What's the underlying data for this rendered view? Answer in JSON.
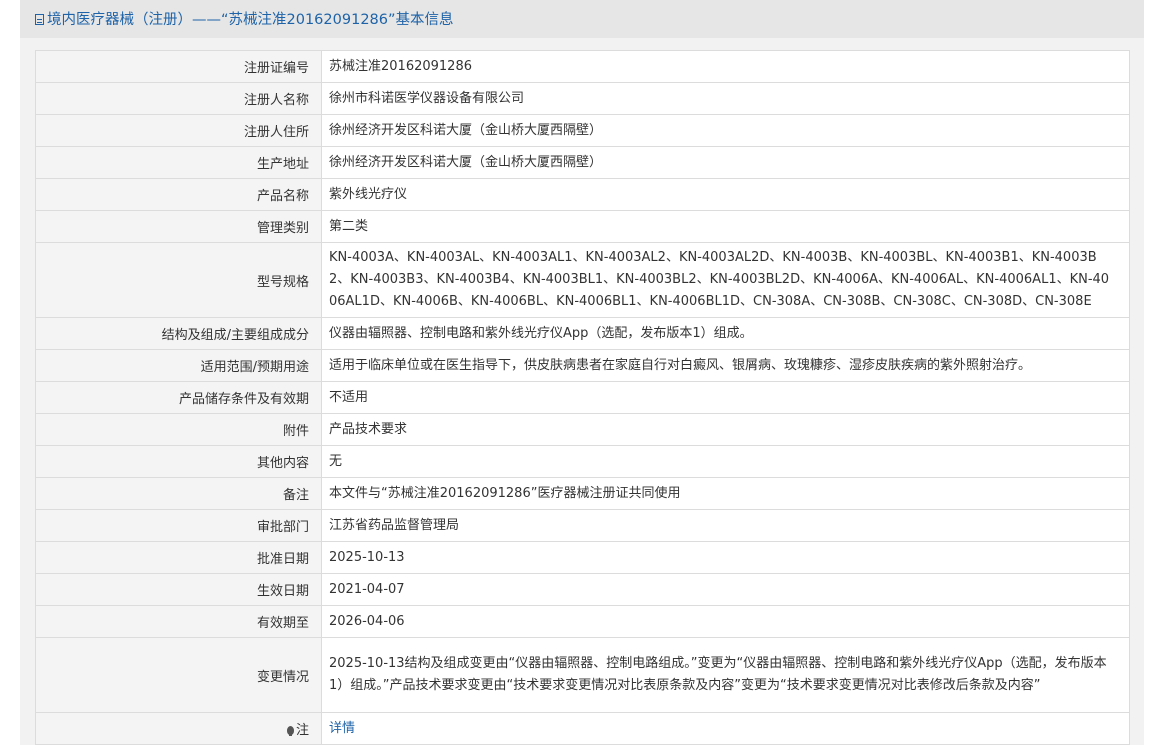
{
  "header": {
    "icon": "document-icon",
    "title": "境内医疗器械（注册）——“苏械注准20162091286”基本信息"
  },
  "rows": [
    {
      "label": "注册证编号",
      "value": "苏械注准20162091286"
    },
    {
      "label": "注册人名称",
      "value": "徐州市科诺医学仪器设备有限公司"
    },
    {
      "label": "注册人住所",
      "value": "徐州经济开发区科诺大厦（金山桥大厦西隔壁）"
    },
    {
      "label": "生产地址",
      "value": "徐州经济开发区科诺大厦（金山桥大厦西隔壁）"
    },
    {
      "label": "产品名称",
      "value": "紫外线光疗仪"
    },
    {
      "label": "管理类别",
      "value": "第二类"
    },
    {
      "label": "型号规格",
      "value": "KN-4003A、KN-4003AL、KN-4003AL1、KN-4003AL2、KN-4003AL2D、KN-4003B、KN-4003BL、KN-4003B1、KN-4003B2、KN-4003B3、KN-4003B4、KN-4003BL1、KN-4003BL2、KN-4003BL2D、KN-4006A、KN-4006AL、KN-4006AL1、KN-4006AL1D、KN-4006B、KN-4006BL、KN-4006BL1、KN-4006BL1D、CN-308A、CN-308B、CN-308C、CN-308D、CN-308E"
    },
    {
      "label": "结构及组成/主要组成成分",
      "value": "仪器由辐照器、控制电路和紫外线光疗仪App（选配，发布版本1）组成。"
    },
    {
      "label": "适用范围/预期用途",
      "value": "适用于临床单位或在医生指导下，供皮肤病患者在家庭自行对白癜风、银屑病、玫瑰糠疹、湿疹皮肤疾病的紫外照射治疗。"
    },
    {
      "label": "产品储存条件及有效期",
      "value": "不适用"
    },
    {
      "label": "附件",
      "value": "产品技术要求"
    },
    {
      "label": "其他内容",
      "value": "无"
    },
    {
      "label": "备注",
      "value": "本文件与“苏械注准20162091286”医疗器械注册证共同使用"
    },
    {
      "label": "审批部门",
      "value": "江苏省药品监督管理局"
    },
    {
      "label": "批准日期",
      "value": "2025-10-13"
    },
    {
      "label": "生效日期",
      "value": "2021-04-07"
    },
    {
      "label": "有效期至",
      "value": "2026-04-06"
    },
    {
      "label": "变更情况",
      "value": "2025-10-13结构及组成变更由“仪器由辐照器、控制电路组成。”变更为“仪器由辐照器、控制电路和紫外线光疗仪App（选配，发布版本1）组成。”产品技术要求变更由“技术要求变更情况对比表原条款及内容”变更为“技术要求变更情况对比表修改后条款及内容”"
    }
  ],
  "note": {
    "icon": "lightbulb-icon",
    "label": "注",
    "link_text": "详情"
  }
}
